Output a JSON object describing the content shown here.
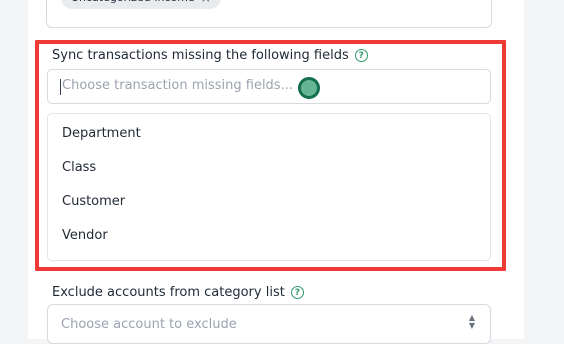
{
  "top_field": {
    "chip_label": "Uncategorized Income",
    "chip_remove": "×"
  },
  "sync_missing_fields": {
    "label": "Sync transactions missing the following fields",
    "help_icon": "?",
    "placeholder": "Choose transaction missing fields...",
    "options": [
      "Department",
      "Class",
      "Customer",
      "Vendor"
    ]
  },
  "exclude_accounts": {
    "label": "Exclude accounts from category list",
    "help_icon": "?",
    "placeholder": "Choose account to exclude",
    "chevron_icon": "chevron-up-down-icon"
  },
  "colors": {
    "highlight": "#ef3b35",
    "accent": "#2f9a6d"
  }
}
